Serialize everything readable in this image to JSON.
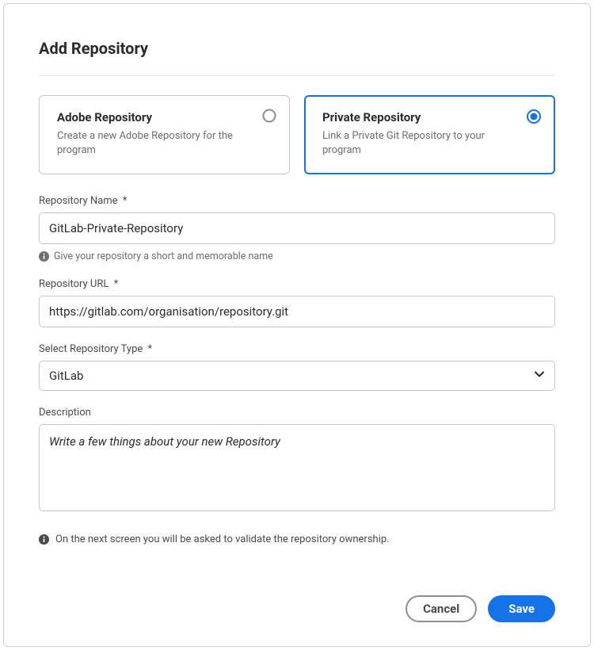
{
  "dialog": {
    "title": "Add Repository"
  },
  "repoTypes": {
    "adobe": {
      "title": "Adobe Repository",
      "desc": "Create a new Adobe Repository for the program",
      "selected": false
    },
    "private": {
      "title": "Private Repository",
      "desc": "Link a Private Git Repository to your program",
      "selected": true
    }
  },
  "fields": {
    "name": {
      "label": "Repository Name",
      "required": "*",
      "value": "GitLab-Private-Repository",
      "hint": "Give your repository a short and memorable name"
    },
    "url": {
      "label": "Repository URL",
      "required": "*",
      "value": "https://gitlab.com/organisation/repository.git"
    },
    "type": {
      "label": "Select Repository Type",
      "required": "*",
      "value": "GitLab"
    },
    "description": {
      "label": "Description",
      "placeholder": "Write a few things about your new Repository"
    }
  },
  "note": "On the next screen you will be asked to validate the repository ownership.",
  "buttons": {
    "cancel": "Cancel",
    "save": "Save"
  }
}
